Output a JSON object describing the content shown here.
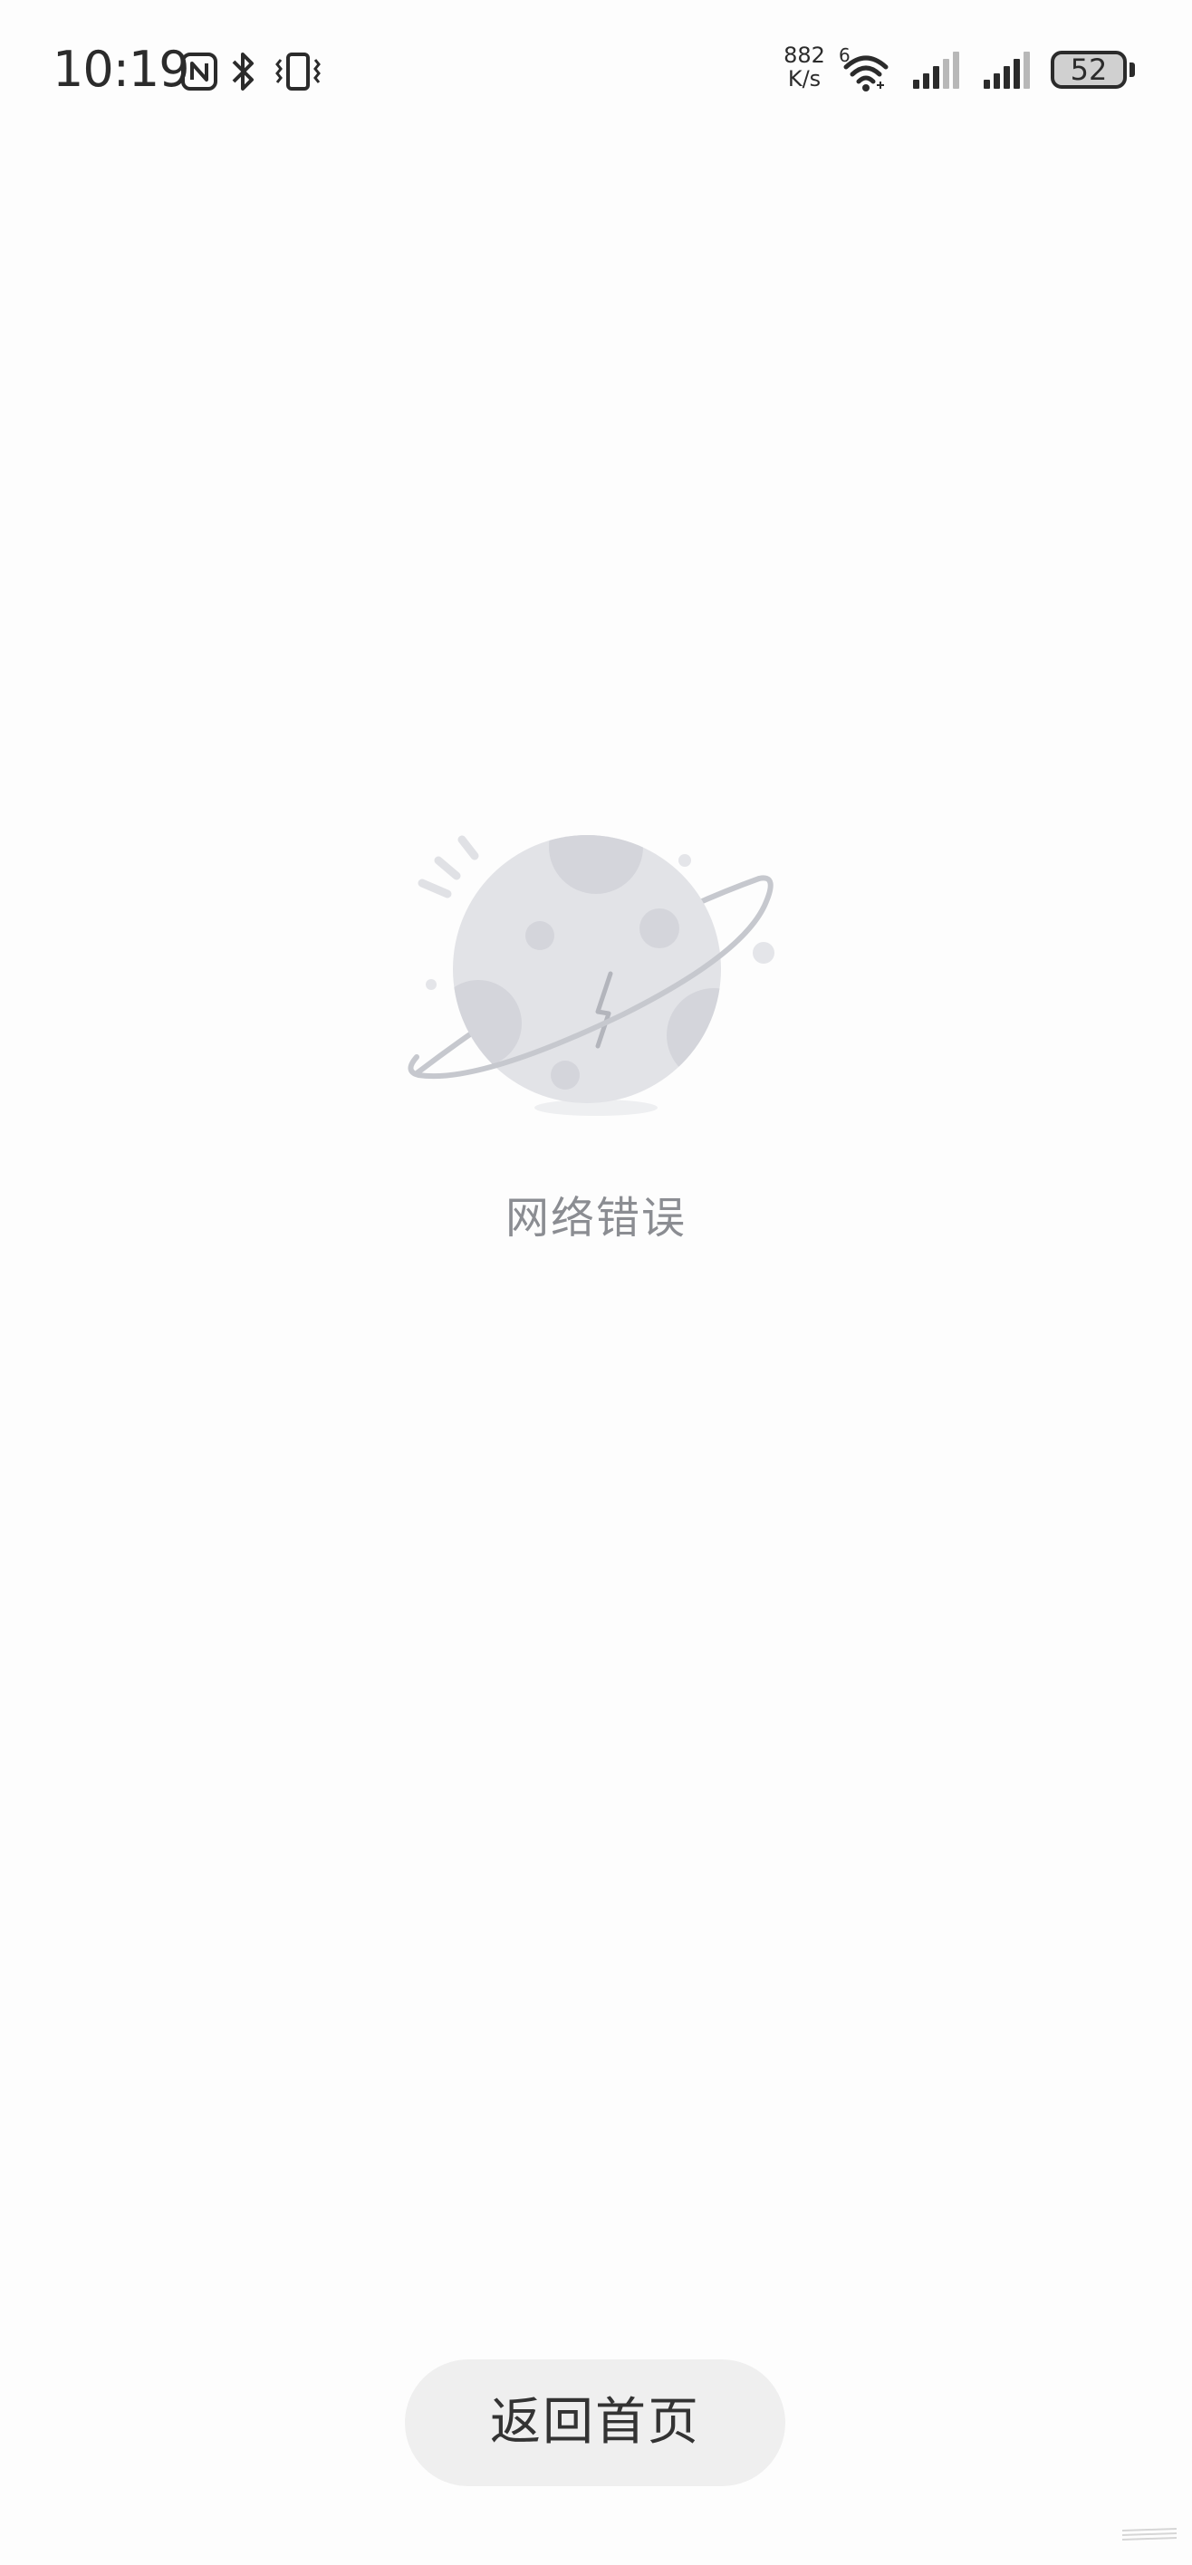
{
  "status_bar": {
    "time": "10:19",
    "net_speed_value": "882",
    "net_speed_unit": "K/s",
    "wifi_generation": "6",
    "battery_level": "52",
    "icons": [
      "nfc-icon",
      "bluetooth-icon",
      "vibrate-icon",
      "wifi-icon",
      "signal-icon",
      "signal-icon",
      "battery-icon"
    ]
  },
  "empty_state": {
    "illustration": "broken-planet-icon",
    "message": "网络错误"
  },
  "actions": {
    "back_home_label": "返回首页"
  },
  "colors": {
    "background": "#fdfdfd",
    "message_text": "#8b8d92",
    "button_background": "#efefef",
    "button_text": "#333333",
    "planet": "#e2e3e7",
    "planet_detail": "#d4d5db",
    "orbit": "#c2c4ca"
  }
}
